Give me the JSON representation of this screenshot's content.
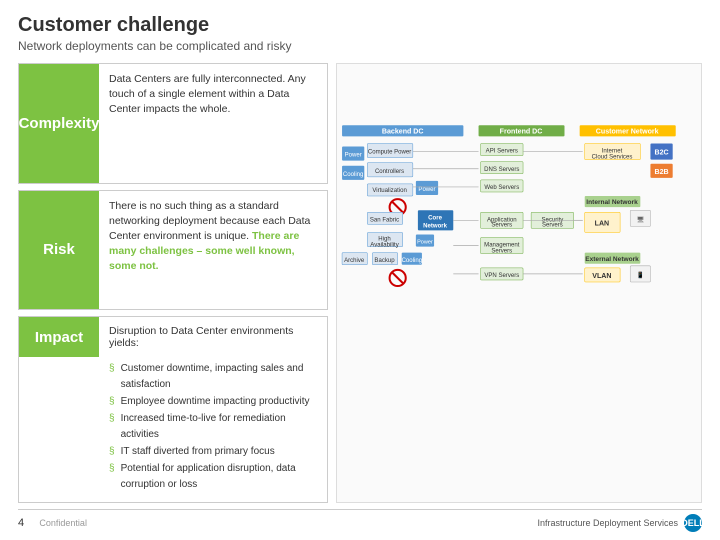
{
  "header": {
    "title": "Customer challenge",
    "subtitle": "Network deployments can be complicated and risky"
  },
  "sections": {
    "complexity": {
      "label": "Complexity",
      "body": "Data Centers are fully interconnected. Any touch of a single element within a Data Center impacts the whole."
    },
    "risk": {
      "label": "Risk",
      "body_normal": "There is no such thing as a standard networking deployment because each Data Center environment is unique.",
      "body_highlight": "There are many challenges – some well known, some not.",
      "highlight_text": "There are many challenges – some well known, some not."
    },
    "impact": {
      "label": "Impact",
      "title": "Disruption to Data Center environments yields:",
      "bullets": [
        "Customer downtime, impacting sales and satisfaction",
        "Employee downtime impacting productivity",
        "Increased time-to-live for remediation activities",
        "IT staff diverted from primary focus",
        "Potential for application disruption, data corruption or loss"
      ]
    }
  },
  "diagram": {
    "backend_dc_label": "Backend DC",
    "frontend_dc_label": "Frontend DC",
    "customer_network_label": "Customer Network",
    "boxes": {
      "power": "Power",
      "compute_power": "Compute Power",
      "cooling": "Cooling",
      "controllers": "Controllers",
      "virtualization": "Virtualization",
      "san_fabric": "San Fabric",
      "core_network": "Core Network",
      "high_availability": "High Availability",
      "power2": "Power",
      "archive": "Archive",
      "backup": "Backup",
      "cooling2": "Cooling",
      "api_servers": "API Servers",
      "dns_servers": "DNS Servers",
      "web_servers": "Web Servers",
      "application_servers": "Application Servers",
      "security_servers": "Security Servers",
      "management_servers": "Management Servers",
      "vpn_servers": "VPN Servers",
      "internet_cloud": "Internet Cloud Services",
      "lan": "LAN",
      "vlan": "VLAN",
      "b2c": "B2C",
      "b2b": "B2B",
      "internal_network": "Internal Network",
      "external_network": "External Network"
    }
  },
  "footer": {
    "page_number": "4",
    "confidential": "Confidential",
    "right_text": "Infrastructure Deployment Services",
    "dell_label": "DELL"
  }
}
